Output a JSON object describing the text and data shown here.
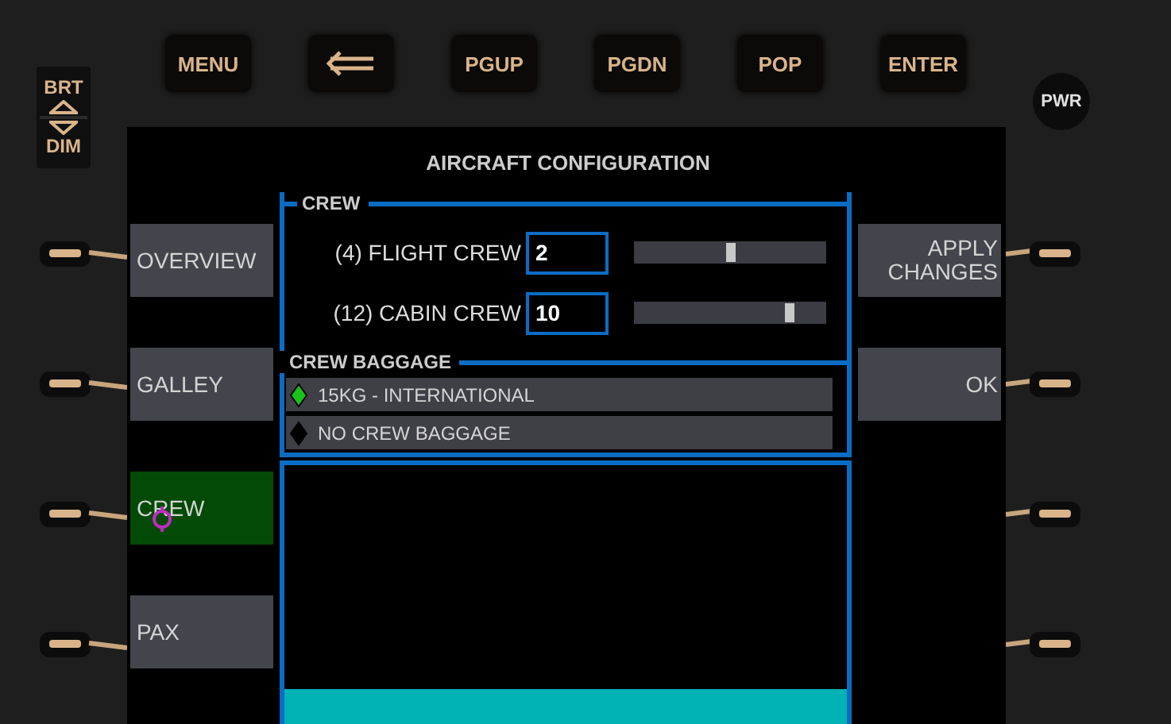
{
  "top_buttons": [
    {
      "kind": "text",
      "label": "MENU"
    },
    {
      "kind": "back"
    },
    {
      "kind": "text",
      "label": "PGUP"
    },
    {
      "kind": "text",
      "label": "PGDN"
    },
    {
      "kind": "text",
      "label": "POP"
    },
    {
      "kind": "text",
      "label": "ENTER"
    }
  ],
  "brightness": {
    "up_label": "BRT",
    "down_label": "DIM"
  },
  "power_button": "PWR",
  "title": "AIRCRAFT CONFIGURATION",
  "left_keys": [
    {
      "label": "OVERVIEW",
      "selected": false
    },
    {
      "label": "GALLEY",
      "selected": false
    },
    {
      "label": "CREW",
      "selected": true
    },
    {
      "label": "PAX",
      "selected": false
    }
  ],
  "right_keys": [
    {
      "label": "APPLY CHANGES"
    },
    {
      "label": "OK"
    }
  ],
  "crew": {
    "heading": "CREW",
    "rows": [
      {
        "label": "(4) FLIGHT CREW",
        "value": "2",
        "level": 0.5
      },
      {
        "label": "(12) CABIN CREW",
        "value": "10",
        "level": 0.81
      }
    ]
  },
  "baggage": {
    "heading": "CREW BAGGAGE",
    "options": [
      {
        "label": "15KG - INTERNATIONAL",
        "selected": true
      },
      {
        "label": "NO CREW BAGGAGE",
        "selected": false
      }
    ]
  }
}
